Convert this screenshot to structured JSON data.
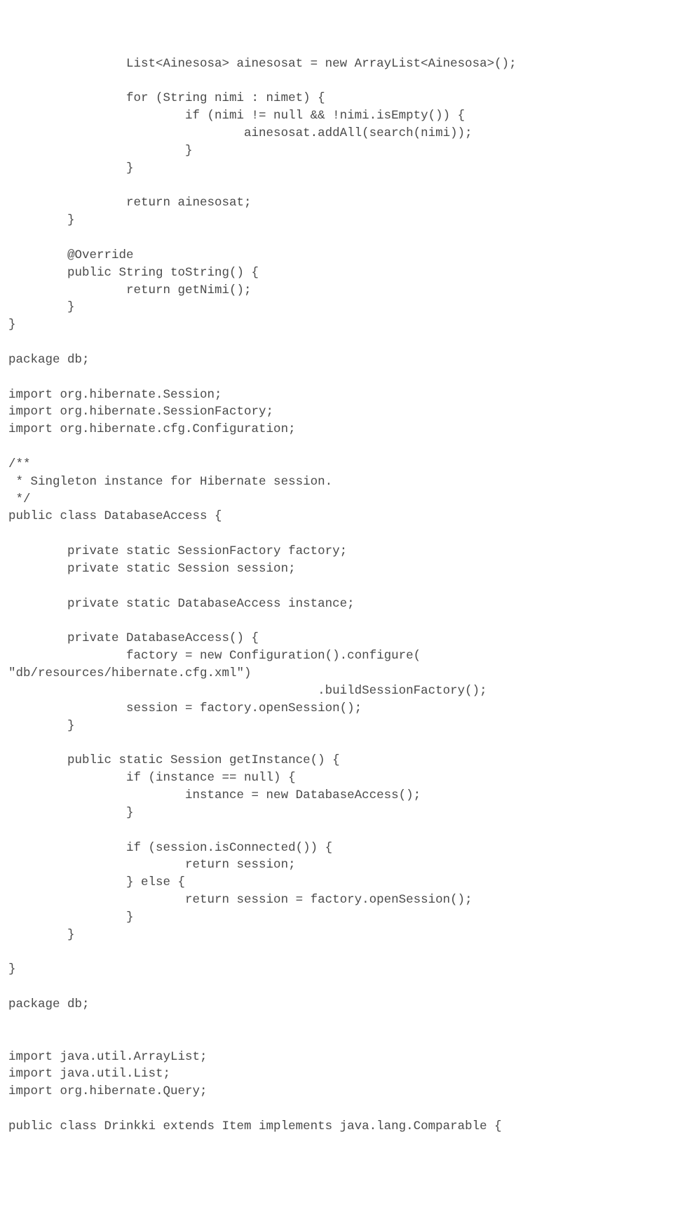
{
  "lines": [
    "                List<Ainesosa> ainesosat = new ArrayList<Ainesosa>();",
    "",
    "                for (String nimi : nimet) {",
    "                        if (nimi != null && !nimi.isEmpty()) {",
    "                                ainesosat.addAll(search(nimi));",
    "                        }",
    "                }",
    "",
    "                return ainesosat;",
    "        }",
    "",
    "        @Override",
    "        public String toString() {",
    "                return getNimi();",
    "        }",
    "}",
    "",
    "package db;",
    "",
    "import org.hibernate.Session;",
    "import org.hibernate.SessionFactory;",
    "import org.hibernate.cfg.Configuration;",
    "",
    "/**",
    " * Singleton instance for Hibernate session.",
    " */",
    "public class DatabaseAccess {",
    "",
    "        private static SessionFactory factory;",
    "        private static Session session;",
    "",
    "        private static DatabaseAccess instance;",
    "",
    "        private DatabaseAccess() {",
    "                factory = new Configuration().configure(",
    "\"db/resources/hibernate.cfg.xml\")",
    "                                          .buildSessionFactory();",
    "                session = factory.openSession();",
    "        }",
    "",
    "        public static Session getInstance() {",
    "                if (instance == null) {",
    "                        instance = new DatabaseAccess();",
    "                }",
    "",
    "                if (session.isConnected()) {",
    "                        return session;",
    "                } else {",
    "                        return session = factory.openSession();",
    "                }",
    "        }",
    "",
    "}",
    "",
    "package db;",
    "",
    "",
    "import java.util.ArrayList;",
    "import java.util.List;",
    "import org.hibernate.Query;",
    "",
    "public class Drinkki extends Item implements java.lang.Comparable {"
  ]
}
